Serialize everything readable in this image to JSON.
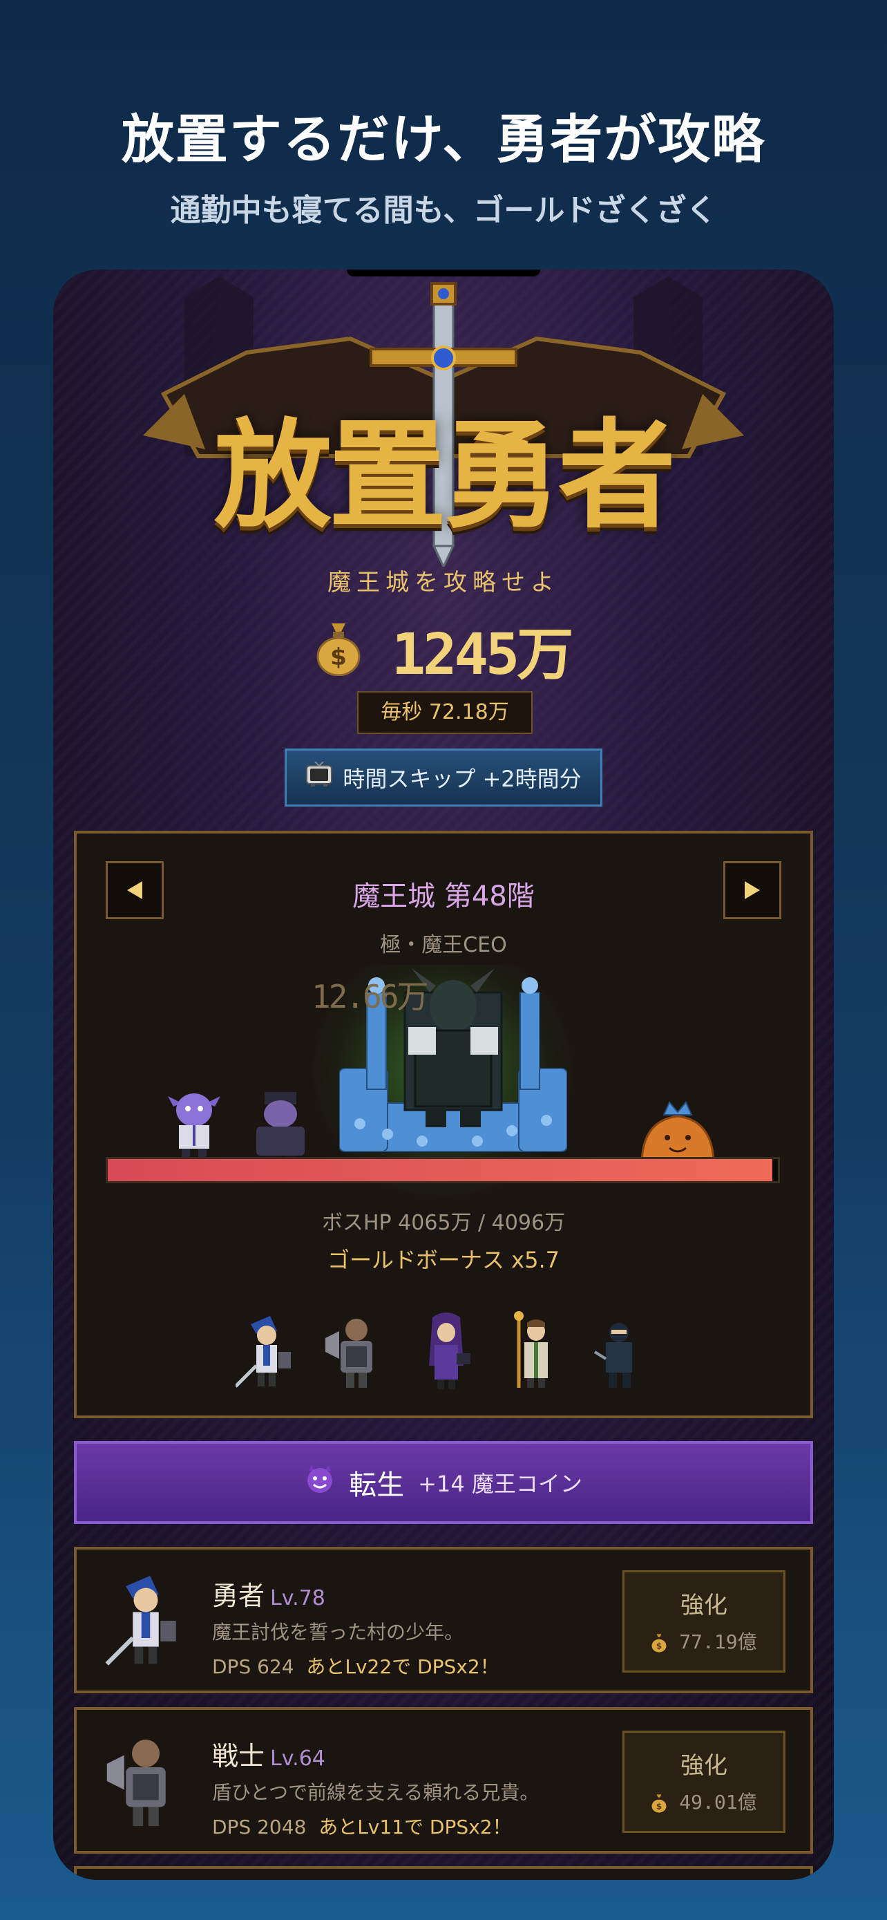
{
  "promo": {
    "headline": "放置するだけ、勇者が攻略",
    "subheadline": "通勤中も寝てる間も、ゴールドざくざく"
  },
  "game": {
    "logo": "放置勇者",
    "tagline": "魔王城を攻略せよ",
    "gold": "1245万",
    "per_second": "毎秒 72.18万",
    "skip_button": "時間スキップ +2時間分",
    "skip_icon": "tv-icon"
  },
  "boss": {
    "floor": "魔王城 第48階",
    "name": "極・魔王CEO",
    "damage_popup": "12.66万",
    "hp_fraction": 0.992,
    "hp_text": "ボスHP 4065万 / 4096万",
    "gold_bonus": "ゴールドボーナス x5.7"
  },
  "reborn": {
    "icon": "devil-face-icon",
    "label": "転生",
    "reward": "+14 魔王コイン"
  },
  "units": [
    {
      "name": "勇者",
      "level": "Lv.78",
      "desc": "魔王討伐を誓った村の少年。",
      "dps": "DPS 624",
      "milestone": "あとLv22で DPSx2！",
      "upgrade_label": "強化",
      "upgrade_cost": "77.19億"
    },
    {
      "name": "戦士",
      "level": "Lv.64",
      "desc": "盾ひとつで前線を支える頼れる兄貴。",
      "dps": "DPS 2048",
      "milestone": "あとLv11で DPSx2！",
      "upgrade_label": "強化",
      "upgrade_cost": "49.01億"
    }
  ],
  "colors": {
    "gold_text": "#e9c26b",
    "panel_border": "#7a5a2c",
    "hp_bar": "#e55a56",
    "reborn_button": "#5a2e98",
    "skip_button": "#1f4670"
  }
}
